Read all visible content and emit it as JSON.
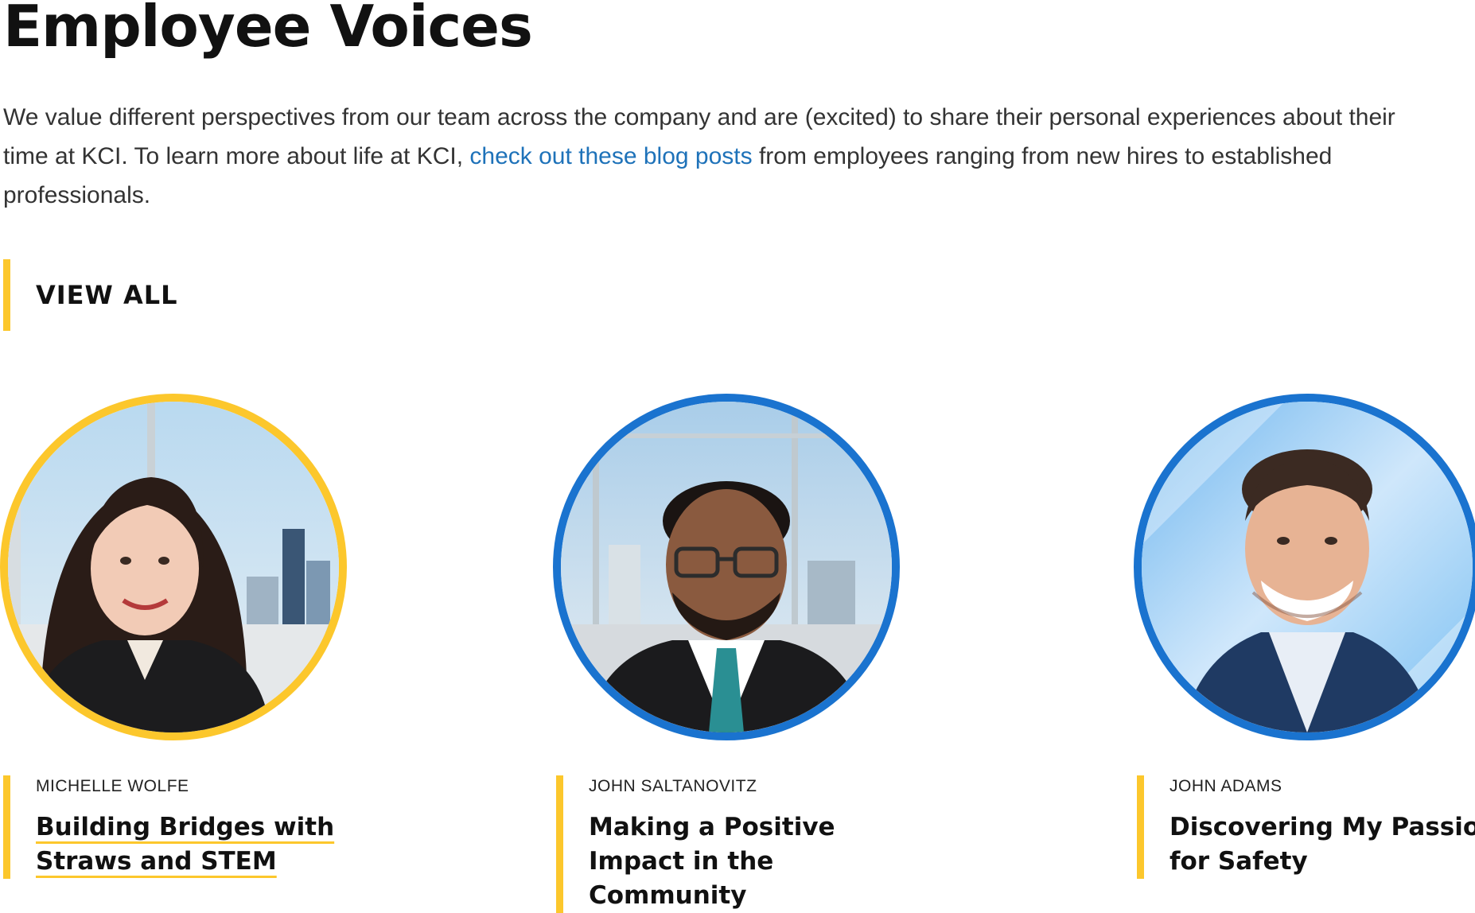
{
  "header": {
    "title": "Employee Voices"
  },
  "intro": {
    "text_before": "We value different perspectives from our team across the company and are (excited) to share their personal experiences about their time at KCI. To learn more about life at KCI, ",
    "link_text": "check out these blog posts",
    "text_after": " from employees ranging from new hires to established professionals."
  },
  "view_all": {
    "label": "VIEW ALL"
  },
  "colors": {
    "accent_yellow": "#fcc72c",
    "accent_blue": "#1a73cf",
    "link_blue": "#1e72b9"
  },
  "posts": [
    {
      "author": "MICHELLE WOLFE",
      "title": "Building Bridges with Straws and STEM",
      "ring_color": "#fcc72c"
    },
    {
      "author": "JOHN SALTANOVITZ",
      "title": "Making a Positive Impact in the Community",
      "ring_color": "#1a73cf"
    },
    {
      "author": "JOHN ADAMS",
      "title": "Discovering My Passion for Safety",
      "ring_color": "#1a73cf"
    }
  ]
}
